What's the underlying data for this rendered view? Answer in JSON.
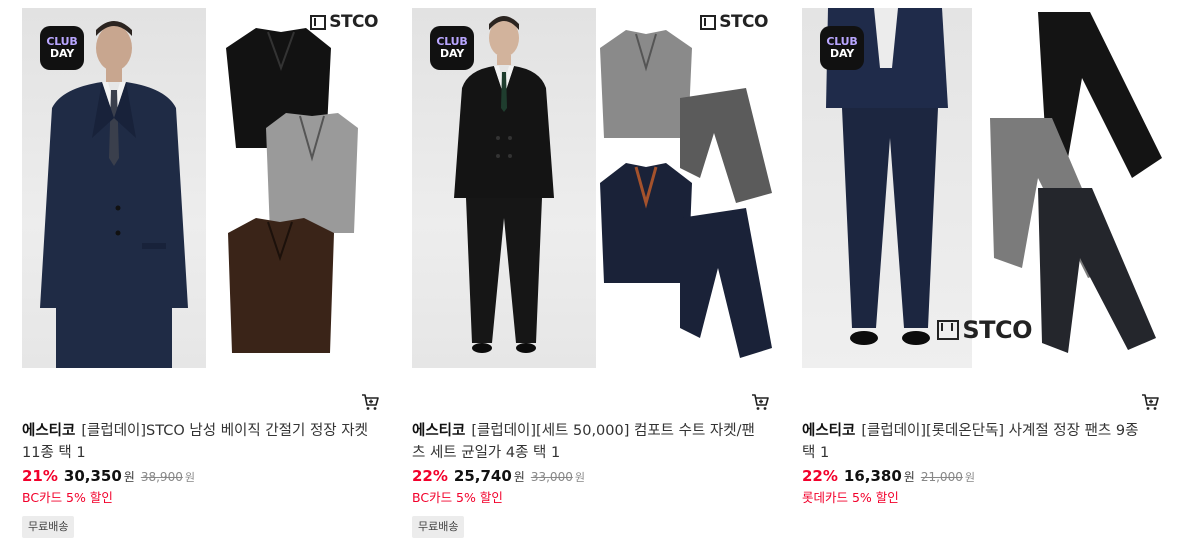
{
  "products": [
    {
      "club_badge": [
        "CLUB",
        "DAY"
      ],
      "brand_logo": "STCO",
      "brand": "에스티코",
      "name": "[클럽데이]STCO 남성 베이직 간절기 정장 자켓 11종 택 1",
      "discount": "21%",
      "price": "30,350",
      "currency": "원",
      "original_price": "38,900",
      "original_currency": "원",
      "card_promo": "BC카드 5% 할인",
      "shipping": "무료배송",
      "icons": {
        "cart": "cart-icon"
      }
    },
    {
      "club_badge": [
        "CLUB",
        "DAY"
      ],
      "brand_logo": "STCO",
      "brand": "에스티코",
      "name": "[클럽데이][세트 50,000] 컴포트 수트 자켓/팬츠 세트 균일가 4종 택 1",
      "discount": "22%",
      "price": "25,740",
      "currency": "원",
      "original_price": "33,000",
      "original_currency": "원",
      "card_promo": "BC카드 5% 할인",
      "shipping": "무료배송",
      "icons": {
        "cart": "cart-icon"
      }
    },
    {
      "club_badge": [
        "CLUB",
        "DAY"
      ],
      "brand_logo": "STCO",
      "brand": "에스티코",
      "name": "[클럽데이][롯데온단독] 사계절 정장 팬츠 9종 택 1",
      "discount": "22%",
      "price": "16,380",
      "currency": "원",
      "original_price": "21,000",
      "original_currency": "원",
      "card_promo": "롯데카드 5% 할인",
      "shipping": "",
      "icons": {
        "cart": "cart-icon"
      }
    }
  ]
}
